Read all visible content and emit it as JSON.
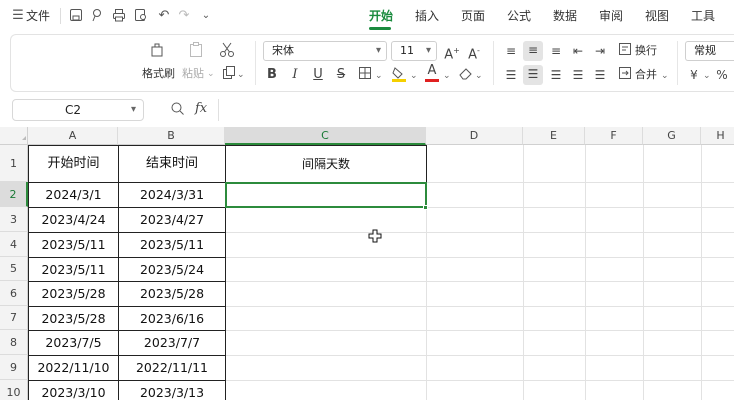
{
  "toolbar": {
    "menu_label": "文件",
    "tabs": [
      {
        "label": "开始",
        "active": true
      },
      {
        "label": "插入"
      },
      {
        "label": "页面"
      },
      {
        "label": "公式"
      },
      {
        "label": "数据"
      },
      {
        "label": "审阅"
      },
      {
        "label": "视图"
      },
      {
        "label": "工具"
      }
    ]
  },
  "ribbon": {
    "format_painter": "格式刷",
    "paste": "粘贴",
    "font_name": "宋体",
    "font_size": "11",
    "wrap_text": "换行",
    "merge": "合并",
    "number_format": "常规"
  },
  "formula_bar": {
    "name_box": "C2",
    "fx": "fx",
    "value": ""
  },
  "sheet": {
    "columns": [
      "A",
      "B",
      "C",
      "D",
      "E",
      "F",
      "G",
      "H"
    ],
    "active_column": "C",
    "active_row": 2,
    "rows": [
      "1",
      "2",
      "3",
      "4",
      "5",
      "6",
      "7",
      "8",
      "9",
      "10"
    ],
    "header": {
      "a": "开始时间",
      "b": "结束时间",
      "c": "间隔天数"
    },
    "data": [
      {
        "a": "2024/3/1",
        "b": "2024/3/31"
      },
      {
        "a": "2023/4/24",
        "b": "2023/4/27"
      },
      {
        "a": "2023/5/11",
        "b": "2023/5/11"
      },
      {
        "a": "2023/5/11",
        "b": "2023/5/24"
      },
      {
        "a": "2023/5/28",
        "b": "2023/5/28"
      },
      {
        "a": "2023/5/28",
        "b": "2023/6/16"
      },
      {
        "a": "2023/7/5",
        "b": "2023/7/7"
      },
      {
        "a": "2022/11/10",
        "b": "2022/11/11"
      },
      {
        "a": "2023/3/10",
        "b": "2023/3/13"
      }
    ]
  },
  "colors": {
    "accent": "#1a8b3e",
    "selection": "#2c8b3c"
  }
}
